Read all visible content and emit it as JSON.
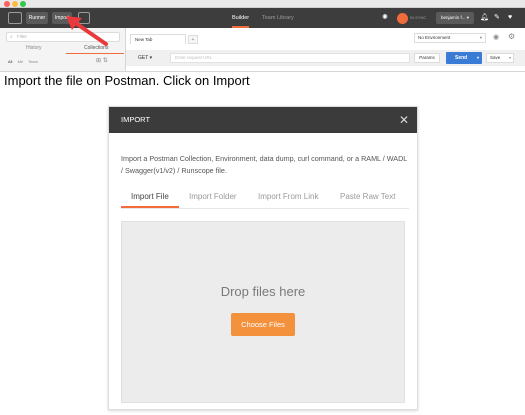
{
  "toolbar": {
    "runner_label": "Runner",
    "import_label": "Import",
    "builder_tab": "Builder",
    "team_library_tab": "Team Library",
    "in_sync_label": "IN SYNC",
    "user_label": "benjamin f... ▾"
  },
  "sidebar": {
    "filter_placeholder": "Filter",
    "tabs": [
      "History",
      "Collections"
    ],
    "filters": [
      "All",
      "Me",
      "Team"
    ]
  },
  "request": {
    "tab_label": "New Tab",
    "plus": "+",
    "environment": "No Environment",
    "method": "GET",
    "url_placeholder": "Enter request URL",
    "params_label": "Params",
    "send_label": "Send",
    "save_label": "Save"
  },
  "caption": "Import the file on Postman. Click on Import",
  "dialog": {
    "title": "IMPORT",
    "description": "Import a Postman Collection, Environment, data dump, curl command, or a RAML / WADL / Swagger(v1/v2) / Runscope file.",
    "tabs": [
      "Import File",
      "Import Folder",
      "Import From Link",
      "Paste Raw Text"
    ],
    "active_tab": "Import File",
    "drop_text": "Drop files here",
    "choose_button": "Choose Files"
  },
  "colors": {
    "accent": "#f26b3a",
    "button_orange": "#f4913d",
    "send_blue": "#3a7bd5",
    "header_dark": "#3b3b3b",
    "arrow_red": "#e8393c"
  }
}
